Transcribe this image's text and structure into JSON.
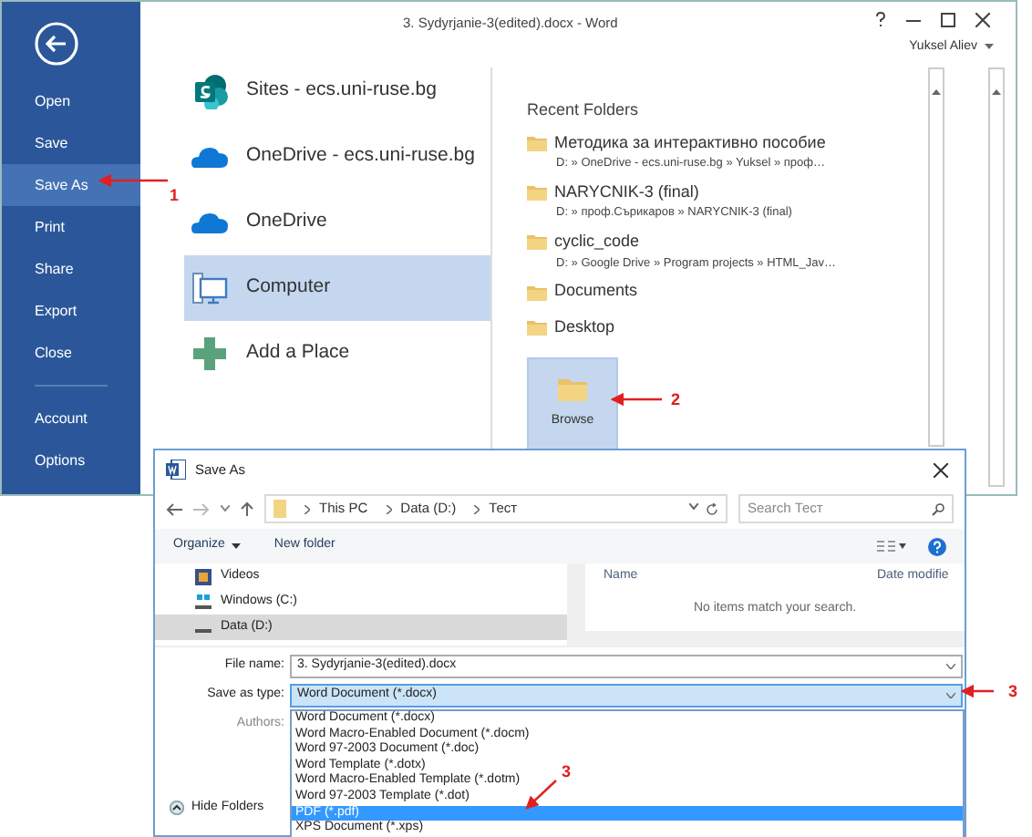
{
  "word_window": {
    "title": "3. Sydyrjanie-3(edited).docx - Word",
    "user": "Yuksel Aliev"
  },
  "backstage_menu": [
    {
      "label": "Open",
      "selected": false
    },
    {
      "label": "Save",
      "selected": false
    },
    {
      "label": "Save As",
      "selected": true
    },
    {
      "label": "Print",
      "selected": false
    },
    {
      "label": "Share",
      "selected": false
    },
    {
      "label": "Export",
      "selected": false
    },
    {
      "label": "Close",
      "selected": false
    }
  ],
  "backstage_menu_bottom": [
    {
      "label": "Account",
      "selected": false
    },
    {
      "label": "Options",
      "selected": false
    }
  ],
  "places": [
    {
      "label": "Sites - ecs.uni-ruse.bg",
      "kind": "sites",
      "selected": false
    },
    {
      "label": "OneDrive - ecs.uni-ruse.bg",
      "kind": "cloud",
      "selected": false
    },
    {
      "label": "OneDrive",
      "kind": "cloud",
      "selected": false
    },
    {
      "label": "Computer",
      "kind": "computer",
      "selected": true
    },
    {
      "label": "Add a Place",
      "kind": "add",
      "selected": false
    }
  ],
  "recent_folders": {
    "heading": "Recent Folders",
    "folders": [
      {
        "name": "Методика за интерактивно пособие",
        "path": "D: » OneDrive - ecs.uni-ruse.bg » Yuksel » проф…"
      },
      {
        "name": "NARYCNIK-3 (final)",
        "path": "D: » проф.Сърикаров » NARYCNIK-3 (final)"
      },
      {
        "name": "cyclic_code",
        "path": "D: » Google Drive » Program projects » HTML_Jav…"
      },
      {
        "name": "Documents"
      },
      {
        "name": "Desktop"
      }
    ]
  },
  "browse": {
    "label": "Browse"
  },
  "annotations": [
    {
      "label": "1",
      "kind": "menu"
    },
    {
      "label": "2",
      "kind": "browse"
    },
    {
      "label": "3",
      "kind": "type"
    },
    {
      "label": "3",
      "kind": "pdf"
    }
  ],
  "dialog": {
    "title": "Save As",
    "breadcrumb": [
      "This PC",
      "Data (D:)",
      "Тест"
    ],
    "search_placeholder": "Search Тест",
    "toolbar": [
      {
        "label": "Organize",
        "kind": "menu"
      },
      {
        "label": "New folder",
        "kind": "plain"
      }
    ],
    "nav_items": [
      {
        "label": "Videos",
        "kind": "videos",
        "selected": false
      },
      {
        "label": "Windows (C:)",
        "kind": "system-drive",
        "selected": false
      },
      {
        "label": "Data (D:)",
        "kind": "drive",
        "selected": true
      }
    ],
    "columns": [
      "Name",
      "Date modifie"
    ],
    "empty_message": "No items match your search.",
    "file_name": {
      "label": "File name:",
      "value": "3. Sydyrjanie-3(edited).docx"
    },
    "save_type": {
      "label": "Save as type:",
      "value": "Word Document (*.docx)",
      "expanded": true
    },
    "type_options": [
      {
        "label": "Word Document (*.docx)",
        "selected": false
      },
      {
        "label": "Word Macro-Enabled Document (*.docm)",
        "selected": false
      },
      {
        "label": "Word 97-2003 Document (*.doc)",
        "selected": false
      },
      {
        "label": "Word Template (*.dotx)",
        "selected": false
      },
      {
        "label": "Word Macro-Enabled Template (*.dotm)",
        "selected": false
      },
      {
        "label": "Word 97-2003 Template (*.dot)",
        "selected": false
      },
      {
        "label": "PDF (*.pdf)",
        "selected": true
      },
      {
        "label": "XPS Document (*.xps)",
        "selected": false
      }
    ],
    "authors_label": "Authors:",
    "hide_folders": "Hide Folders"
  }
}
